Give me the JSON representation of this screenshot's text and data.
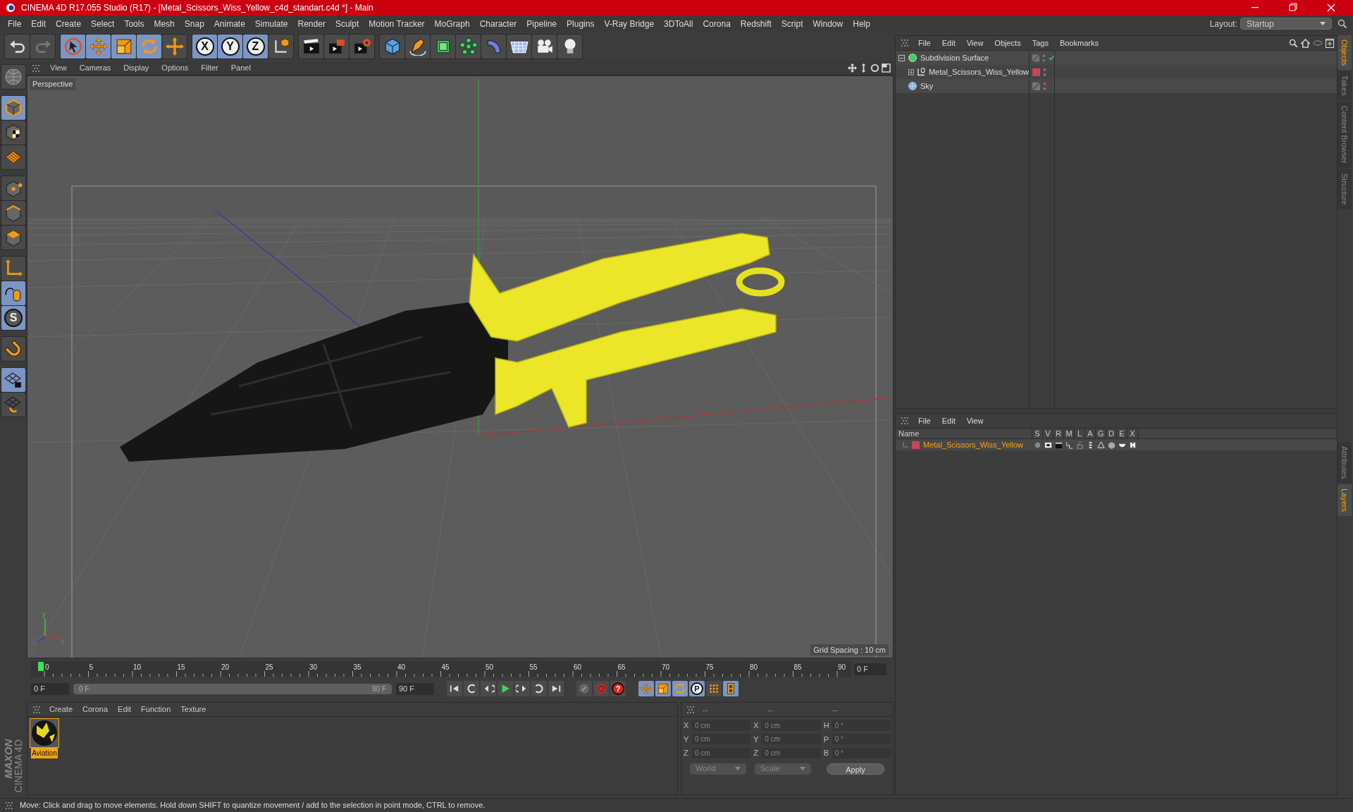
{
  "window": {
    "title": "CINEMA 4D R17.055 Studio (R17) - [Metal_Scissors_Wiss_Yellow_c4d_standart.c4d *] - Main"
  },
  "menu": [
    "File",
    "Edit",
    "Create",
    "Select",
    "Tools",
    "Mesh",
    "Snap",
    "Animate",
    "Simulate",
    "Render",
    "Sculpt",
    "Motion Tracker",
    "MoGraph",
    "Character",
    "Pipeline",
    "Plugins",
    "V-Ray Bridge",
    "3DToAll",
    "Corona",
    "Redshift",
    "Script",
    "Window",
    "Help"
  ],
  "layout": {
    "label": "Layout:",
    "value": "Startup"
  },
  "toolbar": [
    [
      {
        "kind": "undo",
        "active": false
      },
      {
        "kind": "redo",
        "active": false
      }
    ],
    [
      {
        "kind": "select",
        "active": true
      },
      {
        "kind": "move",
        "active": true
      },
      {
        "kind": "scale",
        "active": true
      },
      {
        "kind": "rotate",
        "active": true
      },
      {
        "kind": "transform",
        "active": false
      }
    ],
    [
      {
        "kind": "axis",
        "label": "X",
        "active": true
      },
      {
        "kind": "axis",
        "label": "Y",
        "active": true
      },
      {
        "kind": "axis",
        "label": "Z",
        "active": true
      },
      {
        "kind": "coords",
        "active": false
      }
    ],
    [
      {
        "kind": "render_view",
        "active": false
      },
      {
        "kind": "render_pic",
        "active": false
      },
      {
        "kind": "render_settings",
        "active": false
      }
    ],
    [
      {
        "kind": "cube",
        "active": false
      },
      {
        "kind": "pen",
        "active": false
      },
      {
        "kind": "subdiv",
        "active": false
      },
      {
        "kind": "cloner",
        "active": false
      },
      {
        "kind": "deformer",
        "active": false
      },
      {
        "kind": "floor",
        "active": false
      },
      {
        "kind": "camera",
        "active": false
      },
      {
        "kind": "light",
        "active": false
      }
    ]
  ],
  "left_tools": [
    [
      {
        "kind": "globe",
        "active": false
      }
    ],
    [
      {
        "kind": "model",
        "active": true
      },
      {
        "kind": "texture",
        "active": false
      },
      {
        "kind": "workplane",
        "active": false
      }
    ],
    [
      {
        "kind": "points",
        "active": false
      },
      {
        "kind": "edges",
        "active": false
      },
      {
        "kind": "polygons",
        "active": false
      }
    ],
    [
      {
        "kind": "axis_l",
        "active": false
      },
      {
        "kind": "tweak",
        "active": true
      },
      {
        "kind": "snap",
        "label": "S",
        "active": true
      }
    ],
    [
      {
        "kind": "magnet",
        "active": false
      }
    ],
    [
      {
        "kind": "gridlock",
        "active": true
      },
      {
        "kind": "gridrot",
        "active": false
      }
    ]
  ],
  "brand": [
    "MAXON",
    "CINEMA 4D"
  ],
  "viewport": {
    "menu": [
      "View",
      "Cameras",
      "Display",
      "Options",
      "Filter",
      "Panel"
    ],
    "camera": "Perspective",
    "grid_spacing": "Grid Spacing : 10 cm",
    "gizmo": {
      "x": "x",
      "y": "y",
      "z": "z"
    }
  },
  "timeline": {
    "labels": [
      "0",
      "5",
      "10",
      "15",
      "20",
      "25",
      "30",
      "35",
      "40",
      "45",
      "50",
      "55",
      "60",
      "65",
      "70",
      "75",
      "80",
      "85",
      "90"
    ],
    "level": 0,
    "current": "0 F",
    "start": "0 F",
    "range_start": "0 F",
    "range_end": "90 F",
    "end": "90 F"
  },
  "transport": [
    {
      "kind": "first"
    },
    {
      "kind": "prevkey"
    },
    {
      "kind": "prevframe"
    },
    {
      "kind": "play"
    },
    {
      "kind": "nextframe"
    },
    {
      "kind": "nextkey"
    },
    {
      "kind": "last"
    }
  ],
  "record": [
    {
      "kind": "key",
      "active": false
    },
    {
      "kind": "record",
      "active": false
    },
    {
      "kind": "help",
      "label": "?",
      "active": false
    }
  ],
  "modes": [
    {
      "kind": "move",
      "active": true
    },
    {
      "kind": "scale",
      "active": true
    },
    {
      "kind": "rotate",
      "active": true
    },
    {
      "kind": "param",
      "label": "P",
      "active": true
    },
    {
      "kind": "dots",
      "active": false
    },
    {
      "kind": "film",
      "active": true
    }
  ],
  "materials": {
    "menu": [
      "Create",
      "Corona",
      "Edit",
      "Function",
      "Texture"
    ],
    "items": [
      {
        "name": "Aviation",
        "selected": true
      }
    ]
  },
  "coordinates": {
    "headers": [
      "--",
      "--",
      "--"
    ],
    "rows": [
      [
        {
          "label": "X",
          "value": "0 cm"
        },
        {
          "label": "X",
          "value": "0 cm"
        },
        {
          "label": "H",
          "value": "0 °"
        }
      ],
      [
        {
          "label": "Y",
          "value": "0 cm"
        },
        {
          "label": "Y",
          "value": "0 cm"
        },
        {
          "label": "P",
          "value": "0 °"
        }
      ],
      [
        {
          "label": "Z",
          "value": "0 cm"
        },
        {
          "label": "Z",
          "value": "0 cm"
        },
        {
          "label": "B",
          "value": "0 °"
        }
      ]
    ],
    "dropdowns": [
      "World",
      "Scale"
    ],
    "apply": "Apply"
  },
  "objects": {
    "menu": [
      "File",
      "Edit",
      "View",
      "Objects",
      "Tags",
      "Bookmarks"
    ],
    "tree": [
      {
        "name": "Subdivision Surface",
        "kind": "subdivision",
        "expanded": true,
        "enabled": true,
        "hidden_in_editor": false,
        "children": [
          {
            "name": "Metal_Scissors_Wiss_Yellow",
            "kind": "null",
            "expanded": false,
            "enabled": false,
            "hidden_in_editor": false,
            "color": "#c8435e"
          }
        ]
      },
      {
        "name": "Sky",
        "kind": "sky",
        "enabled": false,
        "hidden_in_editor": true
      }
    ]
  },
  "layers": {
    "menu": [
      "File",
      "Edit",
      "View"
    ],
    "columns": [
      "Name",
      "S",
      "V",
      "R",
      "M",
      "L",
      "A",
      "G",
      "D",
      "E",
      "X"
    ],
    "rows": [
      {
        "name": "Metal_Scissors_Wiss_Yellow",
        "color": "#c8435e",
        "selected": true
      }
    ]
  },
  "side_tabs_top": [
    {
      "label": "Objects",
      "selected": true
    },
    {
      "label": "Takes",
      "selected": false
    },
    {
      "label": "Content Browser",
      "selected": false
    },
    {
      "label": "Structure",
      "selected": false
    }
  ],
  "side_tabs_bottom": [
    {
      "label": "Attributes",
      "selected": false
    },
    {
      "label": "Layers",
      "selected": true
    }
  ],
  "status": "Move: Click and drag to move elements. Hold down SHIFT to quantize movement / add to the selection in point mode, CTRL to remove."
}
